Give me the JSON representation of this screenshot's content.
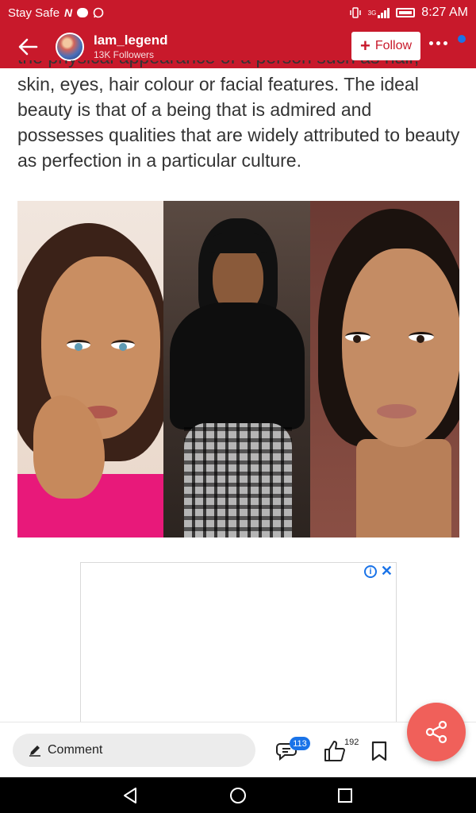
{
  "status_bar": {
    "carrier_text": "Stay Safe",
    "network_badge": "N",
    "signal_type": "3G",
    "time": "8:27 AM",
    "icons": [
      "notification-n-icon",
      "chat-bubble-icon",
      "whatsapp-icon",
      "vibrate-icon",
      "signal-icon",
      "battery-charging-icon"
    ]
  },
  "header": {
    "back_icon": "arrow-left-icon",
    "author_name": "Iam_legend",
    "followers": "13K Followers",
    "follow_label": "Follow",
    "follow_plus": "+",
    "more_icon": "more-horizontal-icon"
  },
  "article": {
    "partial_line": "the physical appearance of a person such as hair,",
    "paragraph": "skin, eyes, hair colour or facial features. The ideal beauty is that of a being that is admired and possesses qualities that are widely attributed to beauty as perfection in a particular culture."
  },
  "image": {
    "panels": [
      "woman-pink-top-portrait",
      "woman-black-outfit-portrait",
      "woman-closeup-portrait"
    ]
  },
  "ad": {
    "info_icon": "i",
    "close_icon": "✕"
  },
  "action_bar": {
    "comment_label": "Comment",
    "comment_count": "113",
    "like_count": "192",
    "icons": [
      "pencil-icon",
      "comment-bubbles-icon",
      "thumbs-up-icon",
      "bookmark-icon",
      "share-icon"
    ]
  },
  "colors": {
    "brand_red": "#c8192b",
    "fab_coral": "#f0605a",
    "badge_blue": "#1a73e8"
  }
}
